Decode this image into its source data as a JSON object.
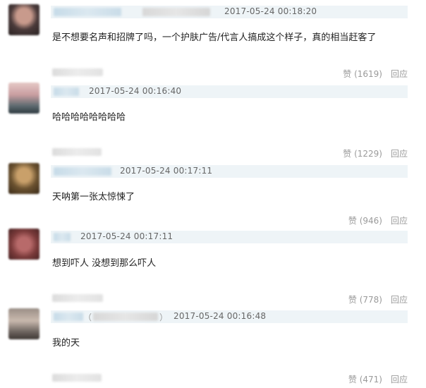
{
  "comments": [
    {
      "timestamp": "2017-05-24 00:18:20",
      "text": "是不想要名声和招牌了吗，一个护肤广告/代言人搞成这个样子，真的相当赶客了",
      "like_label": "赞 (1619)",
      "reply_label": "回应"
    },
    {
      "timestamp": "2017-05-24 00:16:40",
      "text": "哈哈哈哈哈哈哈哈",
      "like_label": "赞 (1229)",
      "reply_label": "回应"
    },
    {
      "timestamp": "2017-05-24 00:17:11",
      "text": "天呐第一张太惊悚了",
      "like_label": "赞 (946)",
      "reply_label": "回应"
    },
    {
      "timestamp": "2017-05-24 00:17:11",
      "text": "想到吓人 没想到那么吓人",
      "like_label": "赞 (778)",
      "reply_label": "回应"
    },
    {
      "paren_open": "（",
      "paren_close": "）",
      "timestamp": "2017-05-24 00:16:48",
      "text": "我的天",
      "like_label": "赞 (471)",
      "reply_label": "回应"
    }
  ],
  "colors": {
    "header_bar": "#eef4f7",
    "meta_text": "#9a9a9a",
    "timestamp_text": "#666666"
  }
}
